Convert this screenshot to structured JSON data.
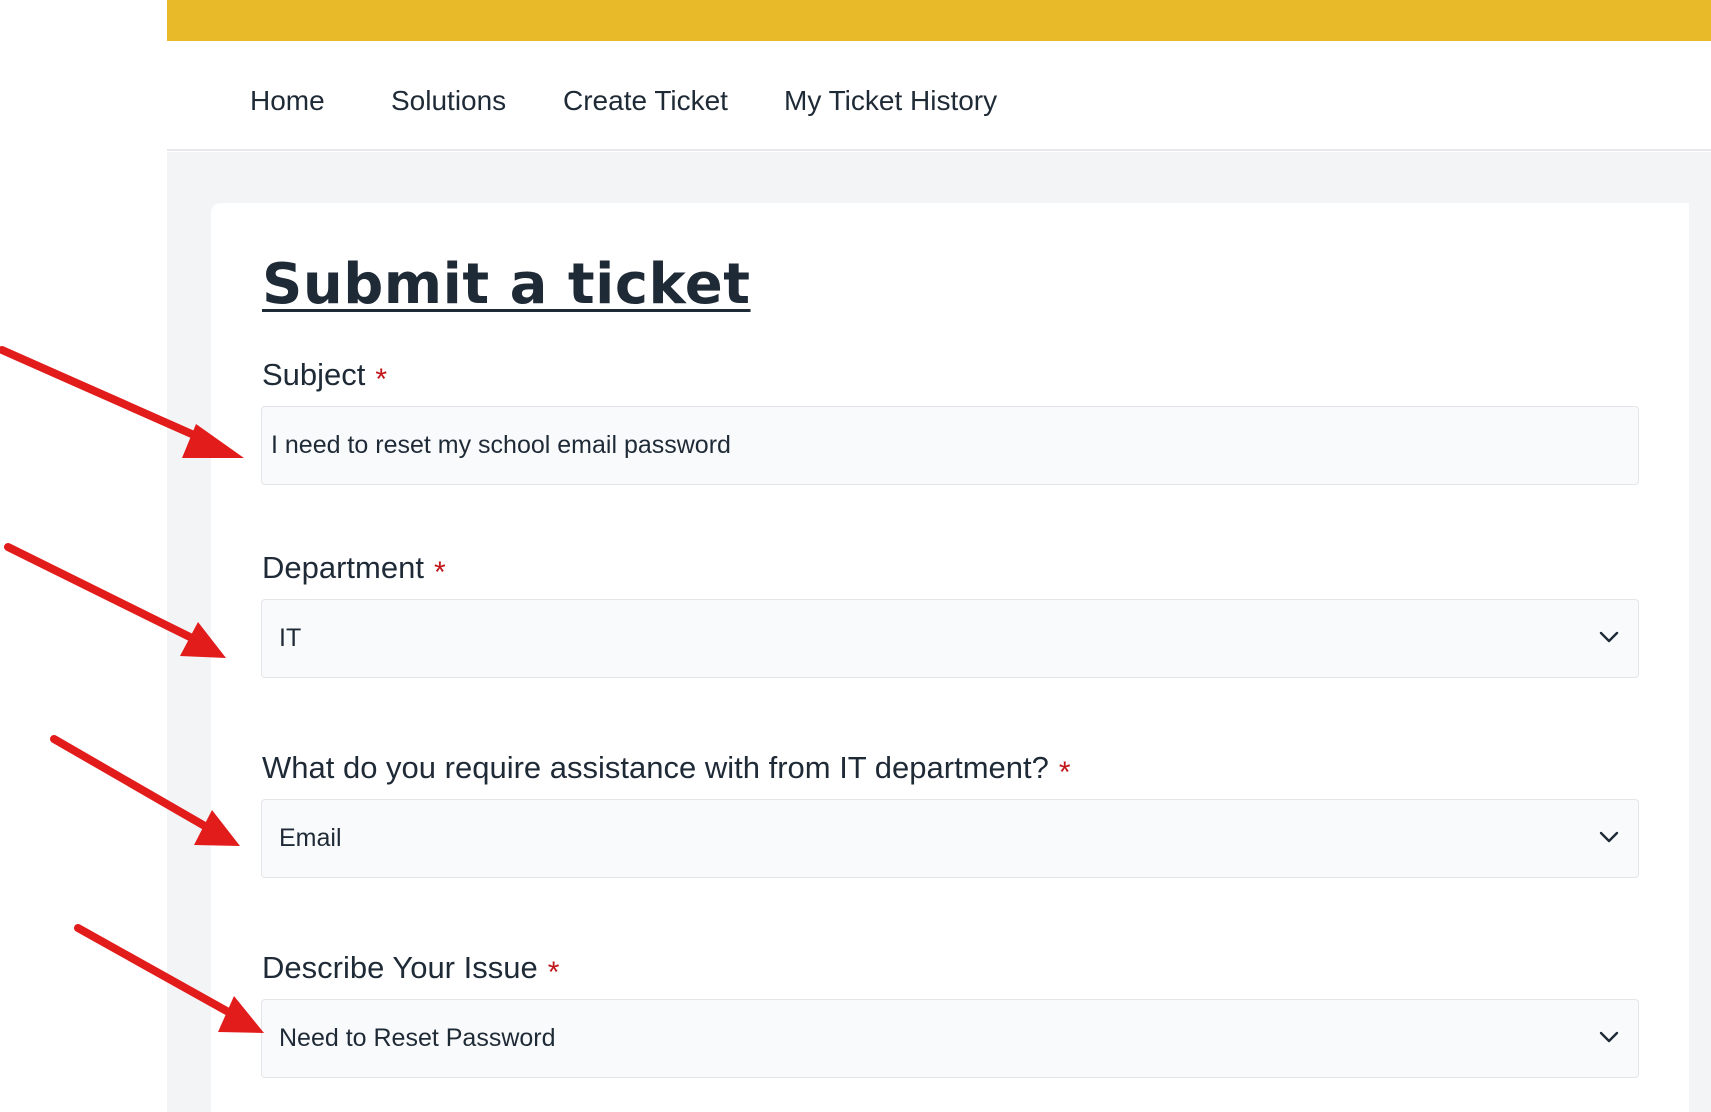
{
  "nav": {
    "items": [
      {
        "label": "Home"
      },
      {
        "label": "Solutions"
      },
      {
        "label": "Create Ticket"
      },
      {
        "label": "My Ticket History"
      }
    ]
  },
  "form": {
    "title": "Submit a ticket",
    "required_marker": "*",
    "subject": {
      "label": "Subject",
      "value": "I need to reset my school email password"
    },
    "department": {
      "label": "Department",
      "value": "IT"
    },
    "assistance": {
      "label": "What do you require assistance with from IT department?",
      "value": "Email"
    },
    "issue": {
      "label": "Describe Your Issue",
      "value": "Need to Reset Password"
    }
  },
  "colors": {
    "top_bar": "#e8b928",
    "required": "#c0161a",
    "annotation_arrow": "#e21b1b"
  },
  "icons": {
    "select_chevron": "chevron-down-icon",
    "annotation": "red-arrow-icon"
  }
}
